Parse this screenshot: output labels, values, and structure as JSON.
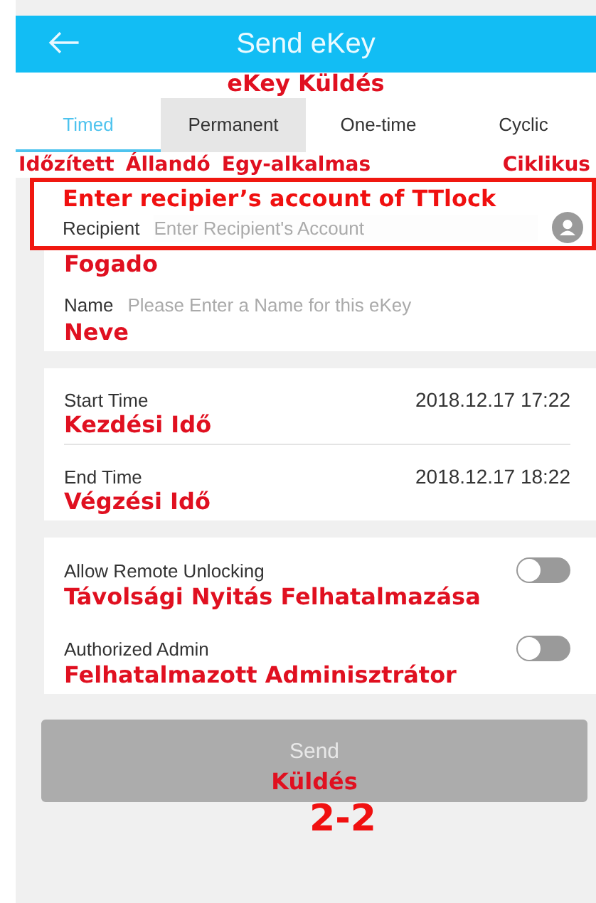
{
  "header": {
    "title": "Send eKey",
    "title_translation": "eKey Küldés"
  },
  "tabs": [
    {
      "label": "Timed",
      "translation": "Időzített",
      "selected": true,
      "pressed": false
    },
    {
      "label": "Permanent",
      "translation": "Állandó",
      "selected": false,
      "pressed": true
    },
    {
      "label": "One-time",
      "translation": "Egy-alkalmas",
      "selected": false,
      "pressed": false
    },
    {
      "label": "Cyclic",
      "translation": "Ciklikus",
      "selected": false,
      "pressed": false
    }
  ],
  "callout": "Enter recipier’s account of TTlock",
  "recipient": {
    "label": "Recipient",
    "placeholder": "Enter Recipient's Account",
    "translation": "Fogado"
  },
  "name": {
    "label": "Name",
    "placeholder": "Please Enter a Name for this eKey",
    "translation": "Neve"
  },
  "times": [
    {
      "label": "Start Time",
      "value": "2018.12.17 17:22",
      "translation": "Kezdési Idő"
    },
    {
      "label": "End Time",
      "value": "2018.12.17 18:22",
      "translation": "Végzési Idő"
    }
  ],
  "toggles": [
    {
      "label": "Allow Remote Unlocking",
      "on": false,
      "translation": "Távolsági Nyitás Felhatalmazása"
    },
    {
      "label": "Authorized Admin",
      "on": false,
      "translation": "Felhatalmazott Adminisztrátor"
    }
  ],
  "send_button": {
    "label": "Send",
    "translation": "Küldés",
    "disabled": true
  },
  "page_number": "2-2"
}
